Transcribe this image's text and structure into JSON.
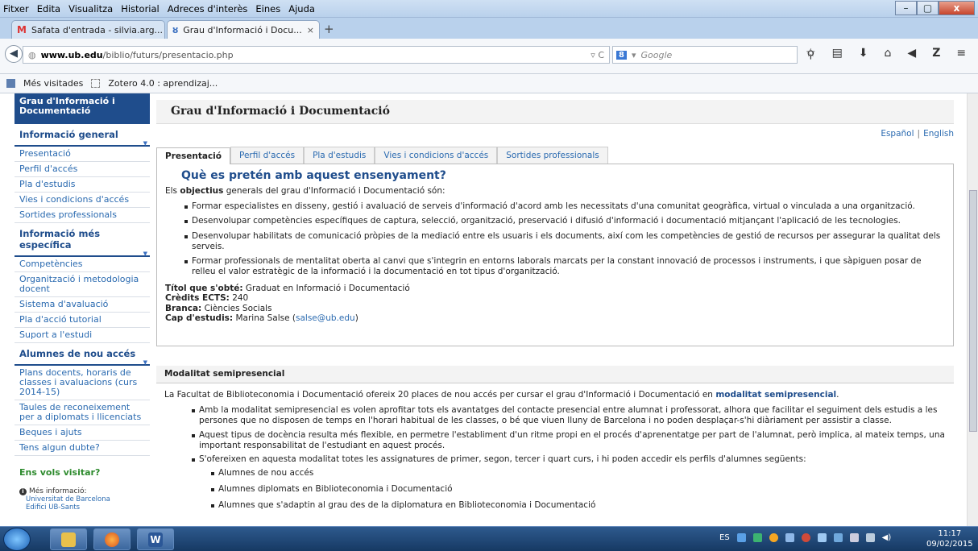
{
  "window": {
    "menu": [
      "Fitxer",
      "Edita",
      "Visualitza",
      "Historial",
      "Adreces d'interès",
      "Eines",
      "Ajuda"
    ],
    "controls": {
      "min": "–",
      "max": "▢",
      "close": "x"
    }
  },
  "tabs": [
    {
      "label": "Safata d'entrada - silvia.arg...",
      "close": "×"
    },
    {
      "label": "Grau d'Informació i Docu...",
      "close": "×"
    }
  ],
  "newtab": "+",
  "nav": {
    "url_domain": "www.ub.edu",
    "url_path": "/biblio/futurs/presentacio.php",
    "url_prefix": "",
    "search_engine": "8",
    "search_placeholder": "Google",
    "reload": "C"
  },
  "bookmarks": {
    "item1": "Més visitades",
    "item2": "Zotero 4.0 : aprendizaj..."
  },
  "sidebar": {
    "top": "Grau d'Informació i Documentació",
    "group1": {
      "title": "Informació general",
      "items": [
        "Presentació",
        "Perfil d'accés",
        "Pla d'estudis",
        "Vies i condicions d'accés",
        "Sortides professionals"
      ]
    },
    "group2": {
      "title": "Informació més específica",
      "items": [
        "Competències",
        "Organització i metodologia docent",
        "Sistema d'avaluació",
        "Pla d'acció tutorial",
        "Suport a l'estudi"
      ]
    },
    "group3": {
      "title": "Alumnes de nou accés",
      "items": [
        "Plans docents, horaris de classes i avaluacions (curs 2014-15)",
        "Taules de reconeixement per a diplomats i llicenciats",
        "Beques i ajuts",
        "Tens algun dubte?"
      ]
    },
    "visit": "Ens vols visitar?",
    "info_label": "Més informació:",
    "info_line1": "Universitat de Barcelona",
    "info_line2": "Edifici UB-Sants"
  },
  "main": {
    "title": "Grau d'Informació i Documentació",
    "lang_es": "Español",
    "lang_sep": "|",
    "lang_en": "English",
    "tabs": [
      "Presentació",
      "Perfil d'accés",
      "Pla d'estudis",
      "Vies i condicions d'accés",
      "Sortides professionals"
    ],
    "heading": "Què es pretén amb aquest ensenyament?",
    "intro_pre": "Els ",
    "intro_bold": "objectius",
    "intro_post": " generals del grau d'Informació i Documentació són:",
    "objectives": [
      "Formar especialistes en disseny, gestió i avaluació de serveis d'informació d'acord amb les necessitats d'una comunitat geogràfica, virtual o vinculada a una organització.",
      "Desenvolupar competències específiques de captura, selecció, organització, preservació i difusió d'informació i documentació mitjançant l'aplicació de les tecnologies.",
      "Desenvolupar habilitats de comunicació pròpies de la mediació entre els usuaris i els documents, així com les competències de gestió de recursos per assegurar la qualitat dels serveis.",
      "Formar professionals de mentalitat oberta al canvi que s'integrin en entorns laborals marcats per la constant innovació de processos i instruments, i que sàpiguen posar de relleu el valor estratègic de la informació i la documentació en tot tipus d'organització."
    ],
    "fields": [
      {
        "label": "Títol que s'obté:",
        "value": " Graduat en Informació i Documentació"
      },
      {
        "label": "Crèdits ECTS:",
        "value": " 240"
      },
      {
        "label": "Branca:",
        "value": " Ciències Socials"
      },
      {
        "label": "Cap d'estudis:",
        "value": " Marina Salse ("
      }
    ],
    "email": "salse@ub.edu",
    "email_close": ")",
    "semi": {
      "title": "Modalitat semipresencial",
      "intro_pre": "La Facultat de Biblioteconomia i Documentació ofereix 20 places de nou accés per cursar el grau d'Informació i Documentació en ",
      "intro_link": "modalitat semipresencial",
      "intro_post": ".",
      "bullets": [
        "Amb la modalitat semipresencial es volen aprofitar tots els avantatges del contacte presencial entre alumnat i professorat, alhora que facilitar el seguiment dels estudis a les persones que no disposen de temps en l'horari habitual de les classes, o bé que viuen lluny de Barcelona i no poden desplaçar-s'hi diàriament per assistir a classe.",
        "Aquest tipus de docència resulta més flexible, en permetre l'establiment d'un ritme propi en el procés d'aprenentatge per part de l'alumnat, però implica, al mateix temps, una important responsabilitat de l'estudiant en aquest procés.",
        "S'ofereixen en aquesta modalitat totes les assignatures de primer, segon, tercer i quart curs, i hi poden accedir els perfils d'alumnes següents:"
      ],
      "profiles": [
        "Alumnes de nou accés",
        "Alumnes diplomats en Biblioteconomia i Documentació",
        "Alumnes que s'adaptin al grau des de la diplomatura en Biblioteconomia i Documentació"
      ]
    }
  },
  "taskbar": {
    "lang": "ES",
    "time": "11:17",
    "date": "09/02/2015",
    "word_letter": "W"
  },
  "colors": {
    "brand": "#1f4d8c",
    "link": "#2a6ab0",
    "green": "#2e8b2e"
  }
}
